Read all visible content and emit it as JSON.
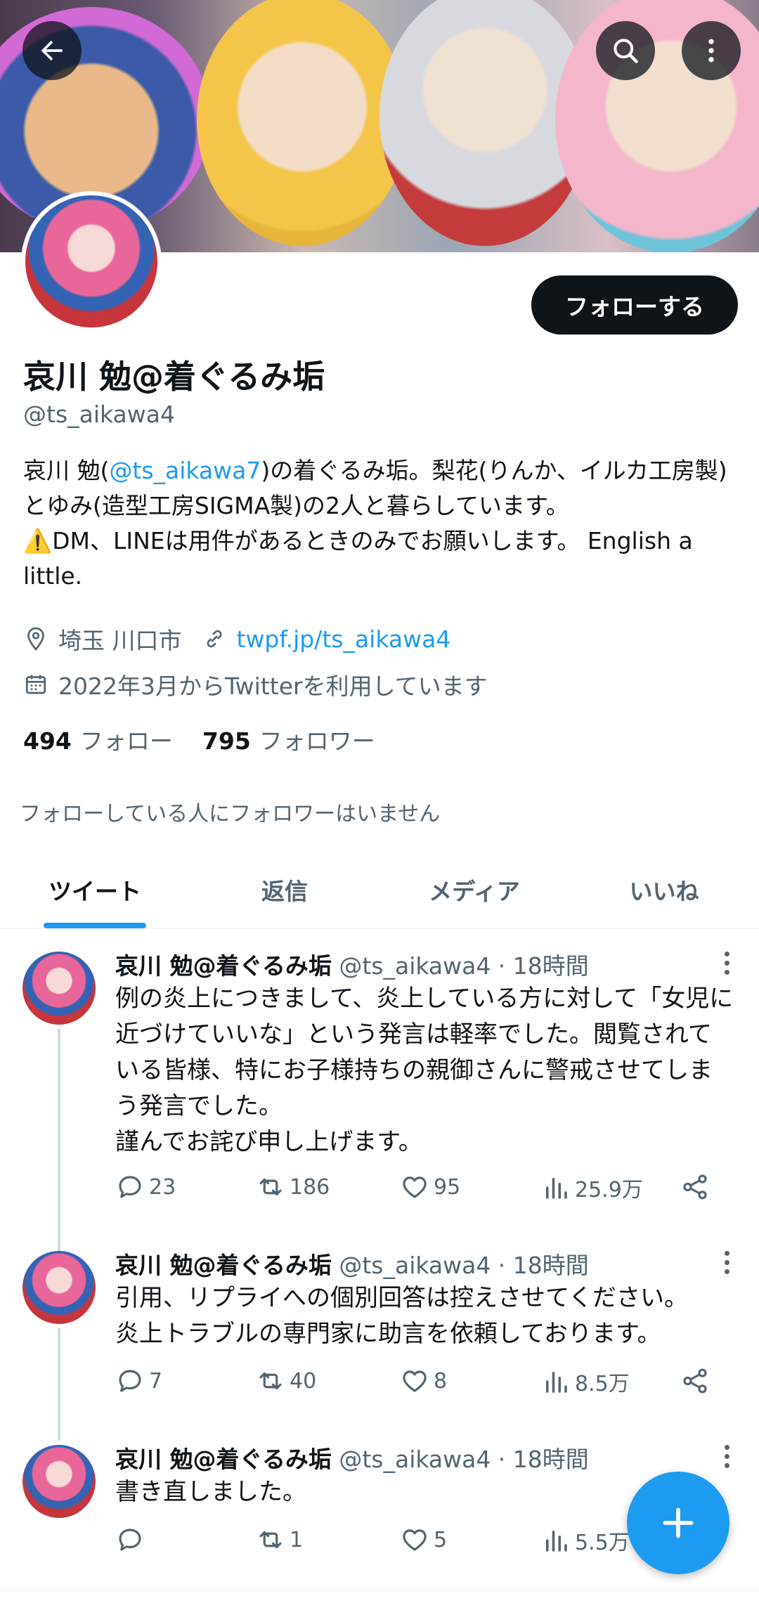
{
  "profile": {
    "follow_label": "フォローする",
    "display_name": "哀川 勉@着ぐるみ垢",
    "handle": "@ts_aikawa4",
    "bio_prefix": "哀川 勉(",
    "bio_mention": "@ts_aikawa7",
    "bio_rest": ")の着ぐるみ垢。梨花(りんか、イルカ工房製)とゆみ(造型工房SIGMA製)の2人と暮らしています。",
    "bio_warning_icon": "⚠️",
    "bio_tail": "DM、LINEは用件があるときのみでお願いします。 English a little.",
    "location": "埼玉 川口市",
    "website": "twpf.jp/ts_aikawa4",
    "joined": "2022年3月からTwitterを利用しています",
    "following_count": "494",
    "following_label": "フォロー",
    "followers_count": "795",
    "followers_label": "フォロワー",
    "followed_by_note": "フォローしている人にフォロワーはいません"
  },
  "tabs": [
    "ツイート",
    "返信",
    "メディア",
    "いいね"
  ],
  "tweets": [
    {
      "name": "哀川 勉@着ぐるみ垢",
      "meta": " @ts_aikawa4 · 18時間",
      "text": "例の炎上につきまして、炎上している方に対して「女児に近づけていいな」という発言は軽率でした。閲覧されている皆様、特にお子様持ちの親御さんに警戒させてしまう発言でした。\n謹んでお詫び申し上げます。",
      "replies": "23",
      "retweets": "186",
      "likes": "95",
      "views": "25.9万"
    },
    {
      "name": "哀川 勉@着ぐるみ垢",
      "meta": " @ts_aikawa4 · 18時間",
      "text": "引用、リプライへの個別回答は控えさせてください。\n炎上トラブルの専門家に助言を依頼しております。",
      "replies": "7",
      "retweets": "40",
      "likes": "8",
      "views": "8.5万"
    },
    {
      "name": "哀川 勉@着ぐるみ垢",
      "meta": " @ts_aikawa4 · 18時間",
      "text": "書き直しました。",
      "replies": "",
      "retweets": "1",
      "likes": "5",
      "views": "5.5万"
    }
  ],
  "icons": {
    "back": "back-arrow-icon",
    "search": "search-icon",
    "more": "more-vertical-icon",
    "location": "location-pin-icon",
    "link": "link-icon",
    "calendar": "calendar-icon",
    "reply": "reply-icon",
    "retweet": "retweet-icon",
    "like": "heart-icon",
    "views": "views-icon",
    "share": "share-icon",
    "compose": "compose-plus-icon"
  },
  "colors": {
    "accent": "#1d9bf0",
    "text": "#0f1419",
    "muted": "#536471"
  }
}
